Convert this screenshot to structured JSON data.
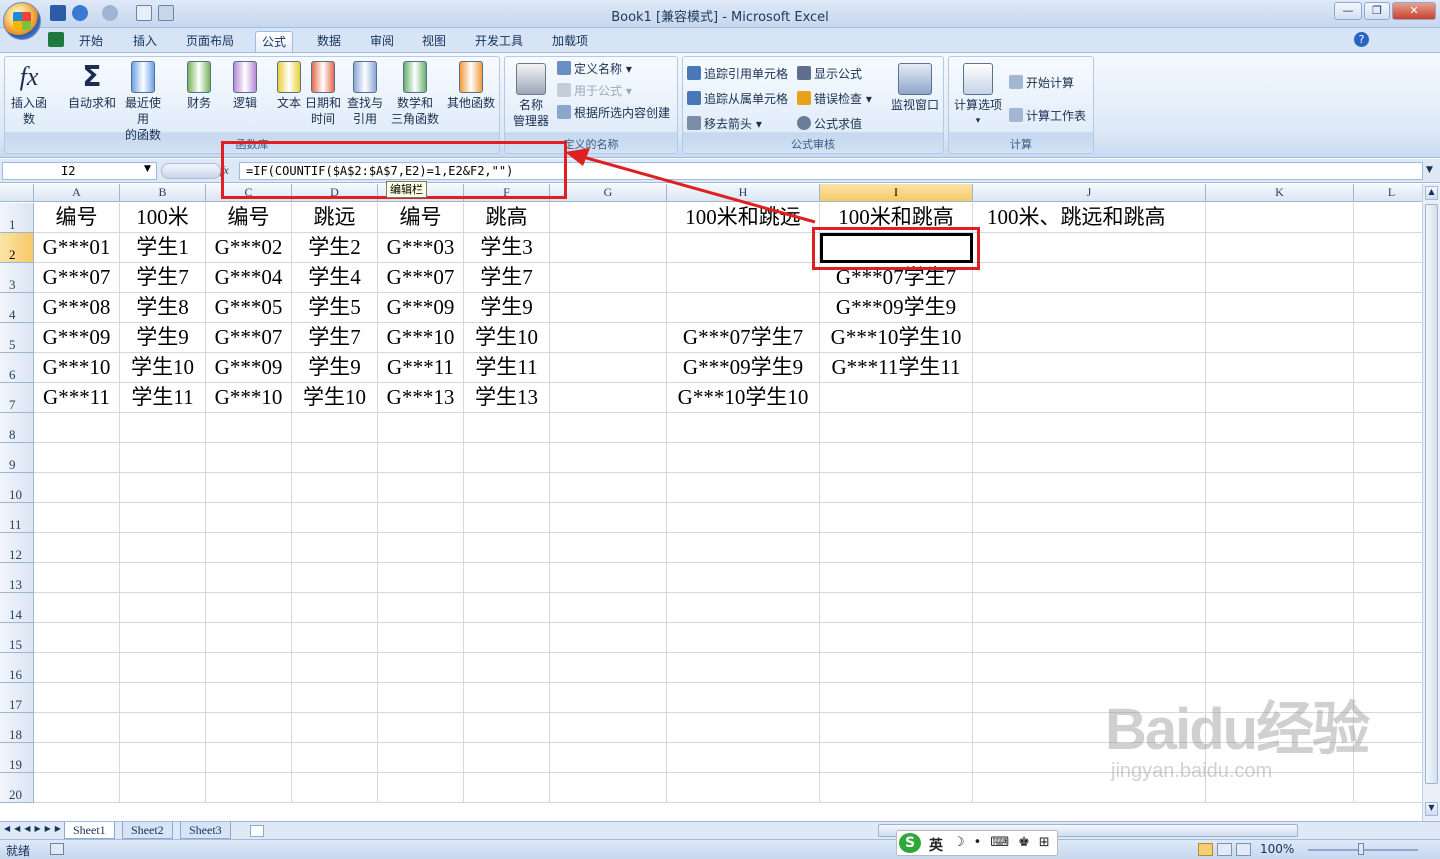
{
  "window": {
    "title": "Book1  [兼容模式] - Microsoft Excel",
    "controls": [
      "—",
      "❐",
      "✕"
    ]
  },
  "tabs": [
    "开始",
    "插入",
    "页面布局",
    "公式",
    "数据",
    "审阅",
    "视图",
    "开发工具",
    "加载项"
  ],
  "ribbon": {
    "function_library": {
      "label": "函数库",
      "buttons": [
        {
          "icon": "fx-icon",
          "label": "插入函数"
        },
        {
          "icon": "sigma-icon",
          "label": "自动求和"
        },
        {
          "icon": "star-book-icon",
          "label": "最近使用\n的函数"
        },
        {
          "icon": "finance-book-icon",
          "label": "财务"
        },
        {
          "icon": "logic-book-icon",
          "label": "逻辑"
        },
        {
          "icon": "text-book-icon",
          "label": "文本"
        },
        {
          "icon": "datetime-book-icon",
          "label": "日期和\n时间"
        },
        {
          "icon": "lookup-book-icon",
          "label": "查找与\n引用"
        },
        {
          "icon": "math-book-icon",
          "label": "数学和\n三角函数"
        },
        {
          "icon": "more-book-icon",
          "label": "其他函数"
        }
      ]
    },
    "defined_names": {
      "label": "定义的名称",
      "manager": "名称\n管理器",
      "items": [
        "定义名称",
        "用于公式",
        "根据所选内容创建"
      ]
    },
    "formula_auditing": {
      "label": "公式审核",
      "col1": [
        "追踪引用单元格",
        "追踪从属单元格",
        "移去箭头"
      ],
      "col2": [
        "显示公式",
        "错误检查",
        "公式求值"
      ],
      "watch": "监视窗口"
    },
    "calculation": {
      "label": "计算",
      "options": "计算选项",
      "items": [
        "开始计算",
        "计算工作表"
      ]
    }
  },
  "formula_bar": {
    "name_box": "I2",
    "fx": "fx",
    "formula": "=IF(COUNTIF($A$2:$A$7,E2)=1,E2&F2,\"\")",
    "tooltip": "编辑栏"
  },
  "columns": [
    "A",
    "B",
    "C",
    "D",
    "E",
    "F",
    "G",
    "H",
    "I",
    "J",
    "K",
    "L"
  ],
  "selected_col": "I",
  "selected_row": 2,
  "rows": [
    [
      "编号",
      "100米",
      "编号",
      "跳远",
      "编号",
      "跳高",
      "",
      "100米和跳远",
      "100米和跳高",
      "100米、跳远和跳高",
      "",
      ""
    ],
    [
      "G***01",
      "学生1",
      "G***02",
      "学生2",
      "G***03",
      "学生3",
      "",
      "",
      "",
      "",
      "",
      ""
    ],
    [
      "G***07",
      "学生7",
      "G***04",
      "学生4",
      "G***07",
      "学生7",
      "",
      "",
      "G***07学生7",
      "",
      "",
      ""
    ],
    [
      "G***08",
      "学生8",
      "G***05",
      "学生5",
      "G***09",
      "学生9",
      "",
      "",
      "G***09学生9",
      "",
      "",
      ""
    ],
    [
      "G***09",
      "学生9",
      "G***07",
      "学生7",
      "G***10",
      "学生10",
      "",
      "G***07学生7",
      "G***10学生10",
      "",
      "",
      ""
    ],
    [
      "G***10",
      "学生10",
      "G***09",
      "学生9",
      "G***11",
      "学生11",
      "",
      "G***09学生9",
      "G***11学生11",
      "",
      "",
      ""
    ],
    [
      "G***11",
      "学生11",
      "G***10",
      "学生10",
      "G***13",
      "学生13",
      "",
      "G***10学生10",
      "",
      "",
      "",
      ""
    ]
  ],
  "row_count": 20,
  "sheets": [
    "Sheet1",
    "Sheet2",
    "Sheet3"
  ],
  "active_sheet": "Sheet1",
  "status": {
    "ready": "就绪",
    "zoom": "100%"
  },
  "ime": {
    "lang": "英"
  },
  "watermark": {
    "brand": "Baidu经验",
    "url": "jingyan.baidu.com"
  }
}
